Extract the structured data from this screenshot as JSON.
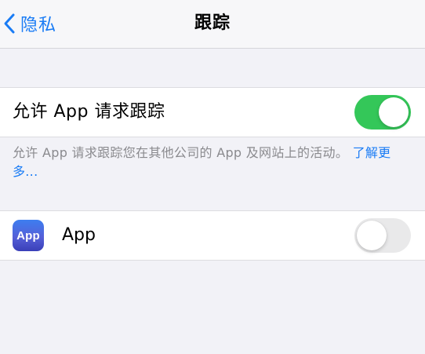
{
  "nav": {
    "back_label": "隐私",
    "title": "跟踪"
  },
  "tracking": {
    "label": "允许 App 请求跟踪",
    "enabled": true,
    "description": "允许 App 请求跟踪您在其他公司的 App 及网站上的活动。",
    "learn_more": "了解更多..."
  },
  "apps": [
    {
      "icon_text": "App",
      "name": "App",
      "enabled": false
    }
  ],
  "colors": {
    "accent": "#1a7cf5",
    "toggle_on": "#34c759",
    "toggle_off": "#e9e9ea",
    "background": "#f2f2f7"
  }
}
